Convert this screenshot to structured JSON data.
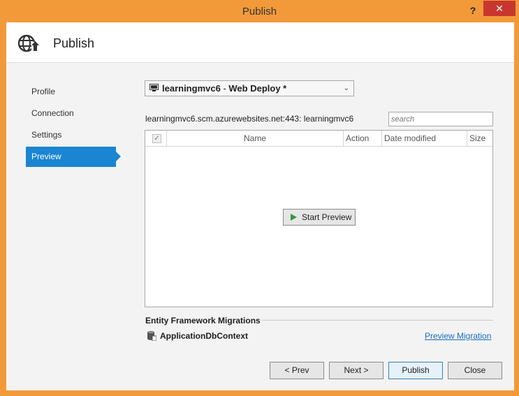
{
  "window": {
    "title": "Publish",
    "help_glyph": "?",
    "close_glyph": "✕"
  },
  "header": {
    "title": "Publish",
    "icon": "globe-arrow-icon"
  },
  "nav": {
    "items": [
      {
        "label": "Profile"
      },
      {
        "label": "Connection"
      },
      {
        "label": "Settings"
      },
      {
        "label": "Preview",
        "active": true
      }
    ]
  },
  "profile": {
    "name": "learningmvc6",
    "separator": " - ",
    "method": "Web Deploy *",
    "arrow": "⌄"
  },
  "server": {
    "text": "learningmvc6.scm.azurewebsites.net:443: learningmvc6"
  },
  "search": {
    "placeholder": "search"
  },
  "grid": {
    "check_glyph": "✓",
    "columns": {
      "name": "Name",
      "action": "Action",
      "date": "Date modified",
      "size": "Size"
    },
    "start_preview_label": "Start Preview"
  },
  "ef": {
    "label": "Entity Framework Migrations",
    "context_label": "ApplicationDbContext",
    "preview_migration_label": "Preview Migration"
  },
  "buttons": {
    "prev": "< Prev",
    "next": "Next >",
    "publish": "Publish",
    "close": "Close"
  },
  "colors": {
    "title_bar": "#f29a3a",
    "nav_active": "#1a85d2",
    "link": "#1a6fc2",
    "close_button": "#c7372f",
    "play_icon": "#2f9a3a"
  }
}
